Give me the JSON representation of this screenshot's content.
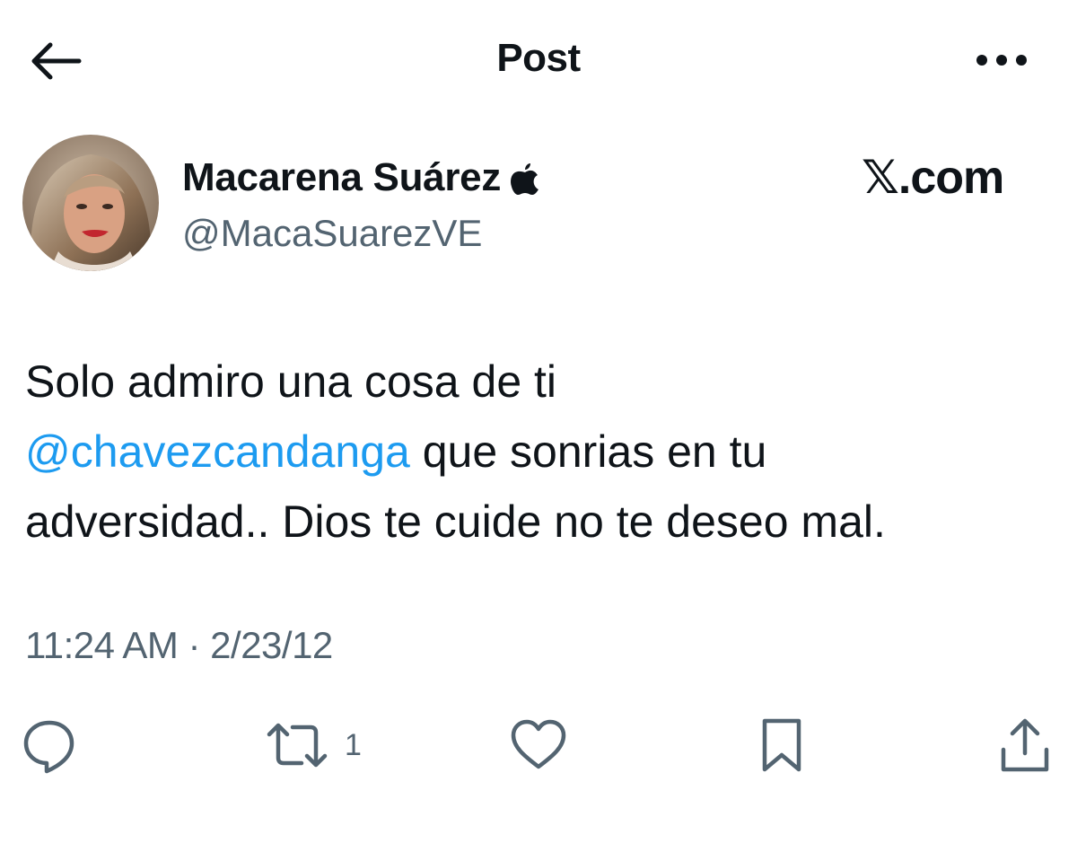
{
  "header": {
    "title": "Post",
    "back_icon": "arrow-left-icon",
    "more_icon": "more-horizontal-icon"
  },
  "author": {
    "name": "Macarena Suárez",
    "name_suffix_icon": "apple-logo-icon",
    "handle": "@MacaSuarezVE"
  },
  "brand": {
    "label": "𝕏.com"
  },
  "tweet": {
    "line1": "Solo admiro una cosa de ti",
    "mention": "@chavezcandanga",
    "after_mention": " que sonrias en tu",
    "line3": "adversidad.. Dios te cuide no te deseo mal."
  },
  "timestamp": "11:24 AM · 2/23/12",
  "actions": {
    "reply_icon": "reply-icon",
    "retweet_icon": "retweet-icon",
    "retweet_count": "1",
    "like_icon": "heart-icon",
    "bookmark_icon": "bookmark-icon",
    "share_icon": "share-icon"
  },
  "colors": {
    "text": "#0f1419",
    "secondary": "#536471",
    "link": "#1d9bf0"
  }
}
